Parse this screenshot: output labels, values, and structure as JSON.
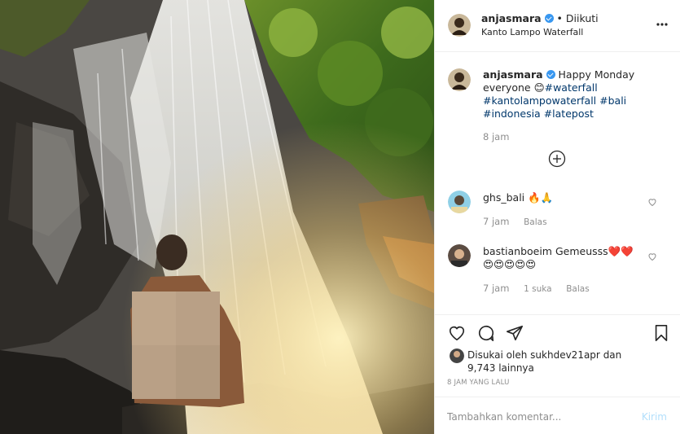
{
  "post": {
    "username": "anjasmara",
    "follow_status": "Diikuti",
    "dot": "•",
    "location": "Kanto Lampo Waterfall"
  },
  "caption": {
    "username": "anjasmara",
    "line1": "Happy Monday",
    "line2_text": "everyone",
    "emoji": "😊",
    "tag1": "#waterfall",
    "tag2": "#kantolampowaterfall",
    "tag3": "#bali",
    "tag4": "#indonesia",
    "tag5": "#latepost",
    "time": "8 jam"
  },
  "comments": [
    {
      "username": "ghs_bali",
      "text": "🔥🙏",
      "time": "7 jam",
      "reply": "Balas",
      "likes": ""
    },
    {
      "username": "bastianboeim",
      "text": "Gemeusss",
      "text2": "❤️❤️",
      "line2": "😍😍😍😍😍",
      "time": "7 jam",
      "likes": "1 suka",
      "reply": "Balas"
    }
  ],
  "likes": {
    "prefix": "Disukai oleh",
    "user": "sukhdev21apr",
    "connector": "dan",
    "count": "9,743",
    "suffix": "lainnya"
  },
  "timestamp": "8 JAM YANG LALU",
  "add_comment": {
    "placeholder": "Tambahkan komentar...",
    "post_label": "Kirim"
  },
  "colors": {
    "link": "#00376b",
    "muted": "#8e8e8e",
    "verified": "#3897f0",
    "post_disabled": "#b2dffc"
  },
  "icons": [
    "more-icon",
    "add-icon",
    "heart-icon",
    "comment-icon",
    "share-icon",
    "bookmark-icon",
    "verified-icon"
  ]
}
